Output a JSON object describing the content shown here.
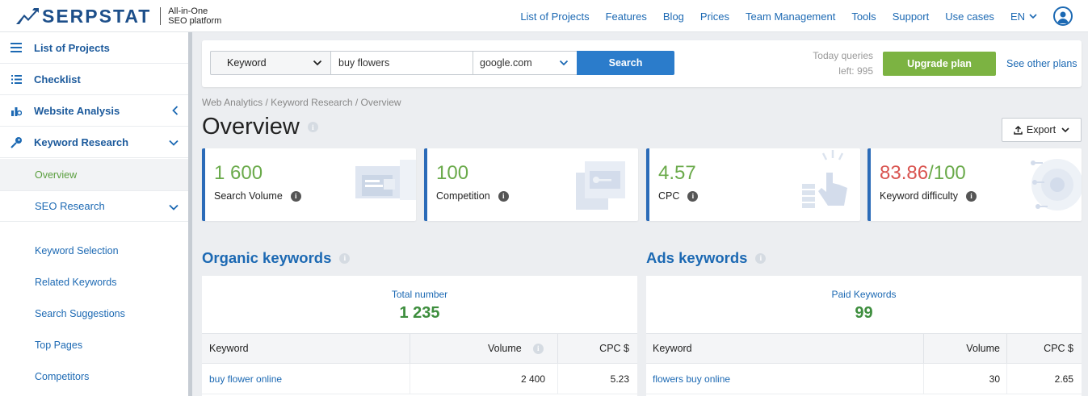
{
  "header": {
    "logo_text": "SERPSTAT",
    "tagline_line1": "All-in-One",
    "tagline_line2": "SEO platform",
    "nav": [
      "List of Projects",
      "Features",
      "Blog",
      "Prices",
      "Team Management",
      "Tools",
      "Support",
      "Use cases"
    ],
    "language": "EN"
  },
  "sidebar": {
    "items": [
      {
        "label": "List of Projects",
        "icon": "menu-lines-icon"
      },
      {
        "label": "Checklist",
        "icon": "checklist-icon"
      },
      {
        "label": "Website Analysis",
        "icon": "analysis-icon"
      },
      {
        "label": "Keyword Research",
        "icon": "key-icon"
      }
    ],
    "keyword_research_sub": {
      "active": "Overview",
      "seo_research": "SEO Research"
    },
    "sub_items": [
      "Keyword Selection",
      "Related Keywords",
      "Search Suggestions",
      "Top Pages",
      "Competitors"
    ]
  },
  "search": {
    "type": "Keyword",
    "query": "buy flowers",
    "engine": "google.com",
    "button": "Search",
    "queries_line1": "Today queries",
    "queries_line2": "left: 995",
    "upgrade": "Upgrade plan",
    "see_plans": "See other plans"
  },
  "page": {
    "breadcrumb": "Web Analytics / Keyword Research / Overview",
    "title": "Overview",
    "export": "Export"
  },
  "metrics": [
    {
      "value": "1 600",
      "label": "Search Volume"
    },
    {
      "value": "100",
      "label": "Competition"
    },
    {
      "value": "4.57",
      "label": "CPC"
    },
    {
      "value_red": "83.86",
      "value_rest": "/100",
      "label": "Keyword difficulty"
    }
  ],
  "colors": {
    "brand": "#1d4f8a",
    "link": "#1c69b3",
    "search_button": "#2b7ccb",
    "upgrade_button": "#7cb342",
    "metric_green": "#6aaa4a",
    "difficulty_red": "#d9534f"
  },
  "organic": {
    "title": "Organic keywords",
    "summary_label": "Total number",
    "summary_value": "1 235",
    "columns": [
      "Keyword",
      "Volume",
      "CPC $"
    ],
    "rows": [
      {
        "keyword": "buy flower online",
        "volume": "2 400",
        "cpc": "5.23"
      }
    ]
  },
  "ads": {
    "title": "Ads keywords",
    "summary_label": "Paid Keywords",
    "summary_value": "99",
    "columns": [
      "Keyword",
      "Volume",
      "CPC $"
    ],
    "rows": [
      {
        "keyword": "flowers buy online",
        "volume": "30",
        "cpc": "2.65"
      }
    ]
  }
}
